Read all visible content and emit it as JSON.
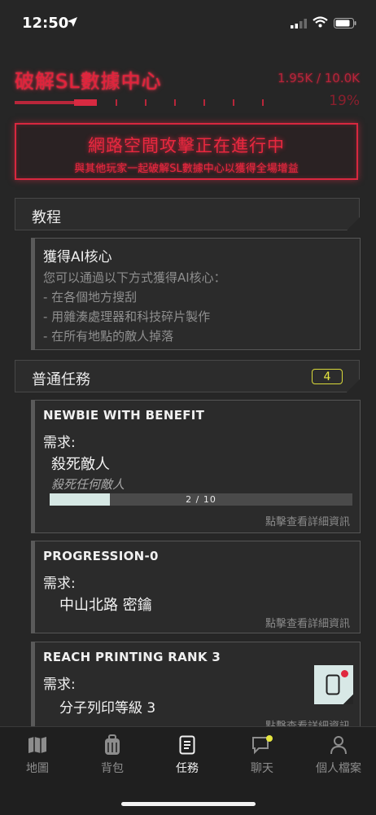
{
  "status_bar": {
    "time": "12:50"
  },
  "header": {
    "title": "破解SL數據中心",
    "progress_text": "1.95K / 10.0K",
    "percent_text": "19%",
    "progress_fraction": 0.195
  },
  "banner": {
    "title": "網路空間攻擊正在進行中",
    "subtitle": "與其他玩家一起破解SL數據中心以獲得全場增益"
  },
  "tutorial_section": {
    "label": "教程"
  },
  "tutorial_card": {
    "title": "獲得AI核心",
    "lines": [
      "您可以通過以下方式獲得AI核心：",
      "- 在各個地方搜刮",
      "- 用雜湊處理器和科技碎片製作",
      "- 在所有地點的敵人掉落"
    ]
  },
  "quests_section": {
    "label": "普通任務",
    "count": "4"
  },
  "quests": [
    {
      "title": "NEWBIE WITH BENEFIT",
      "requirement_label": "需求:",
      "objective": "殺死敵人",
      "objective_sub": "殺死任何敵人",
      "progress_text": "2  /  10",
      "progress_fraction": 0.2,
      "details_link": "點擊查看詳細資訊"
    },
    {
      "title": "PROGRESSION-0",
      "requirement_label": "需求:",
      "objective": "中山北路 密鑰",
      "details_link": "點擊查看詳細資訊"
    },
    {
      "title": "REACH PRINTING RANK 3",
      "requirement_label": "需求:",
      "objective": "分子列印等級 3",
      "details_link": "點擊查看詳細資訊"
    }
  ],
  "tab_bar": {
    "tabs": [
      {
        "label": "地圖",
        "icon": "map-icon"
      },
      {
        "label": "背包",
        "icon": "backpack-icon"
      },
      {
        "label": "任務",
        "icon": "document-icon"
      },
      {
        "label": "聊天",
        "icon": "chat-icon"
      },
      {
        "label": "個人檔案",
        "icon": "person-icon"
      }
    ],
    "active_tab": "任務"
  },
  "colors": {
    "background": "#262626",
    "alert_red": "#e3223b",
    "badge_yellow": "#e6e640",
    "progress_fill": "#d6e8e4"
  }
}
